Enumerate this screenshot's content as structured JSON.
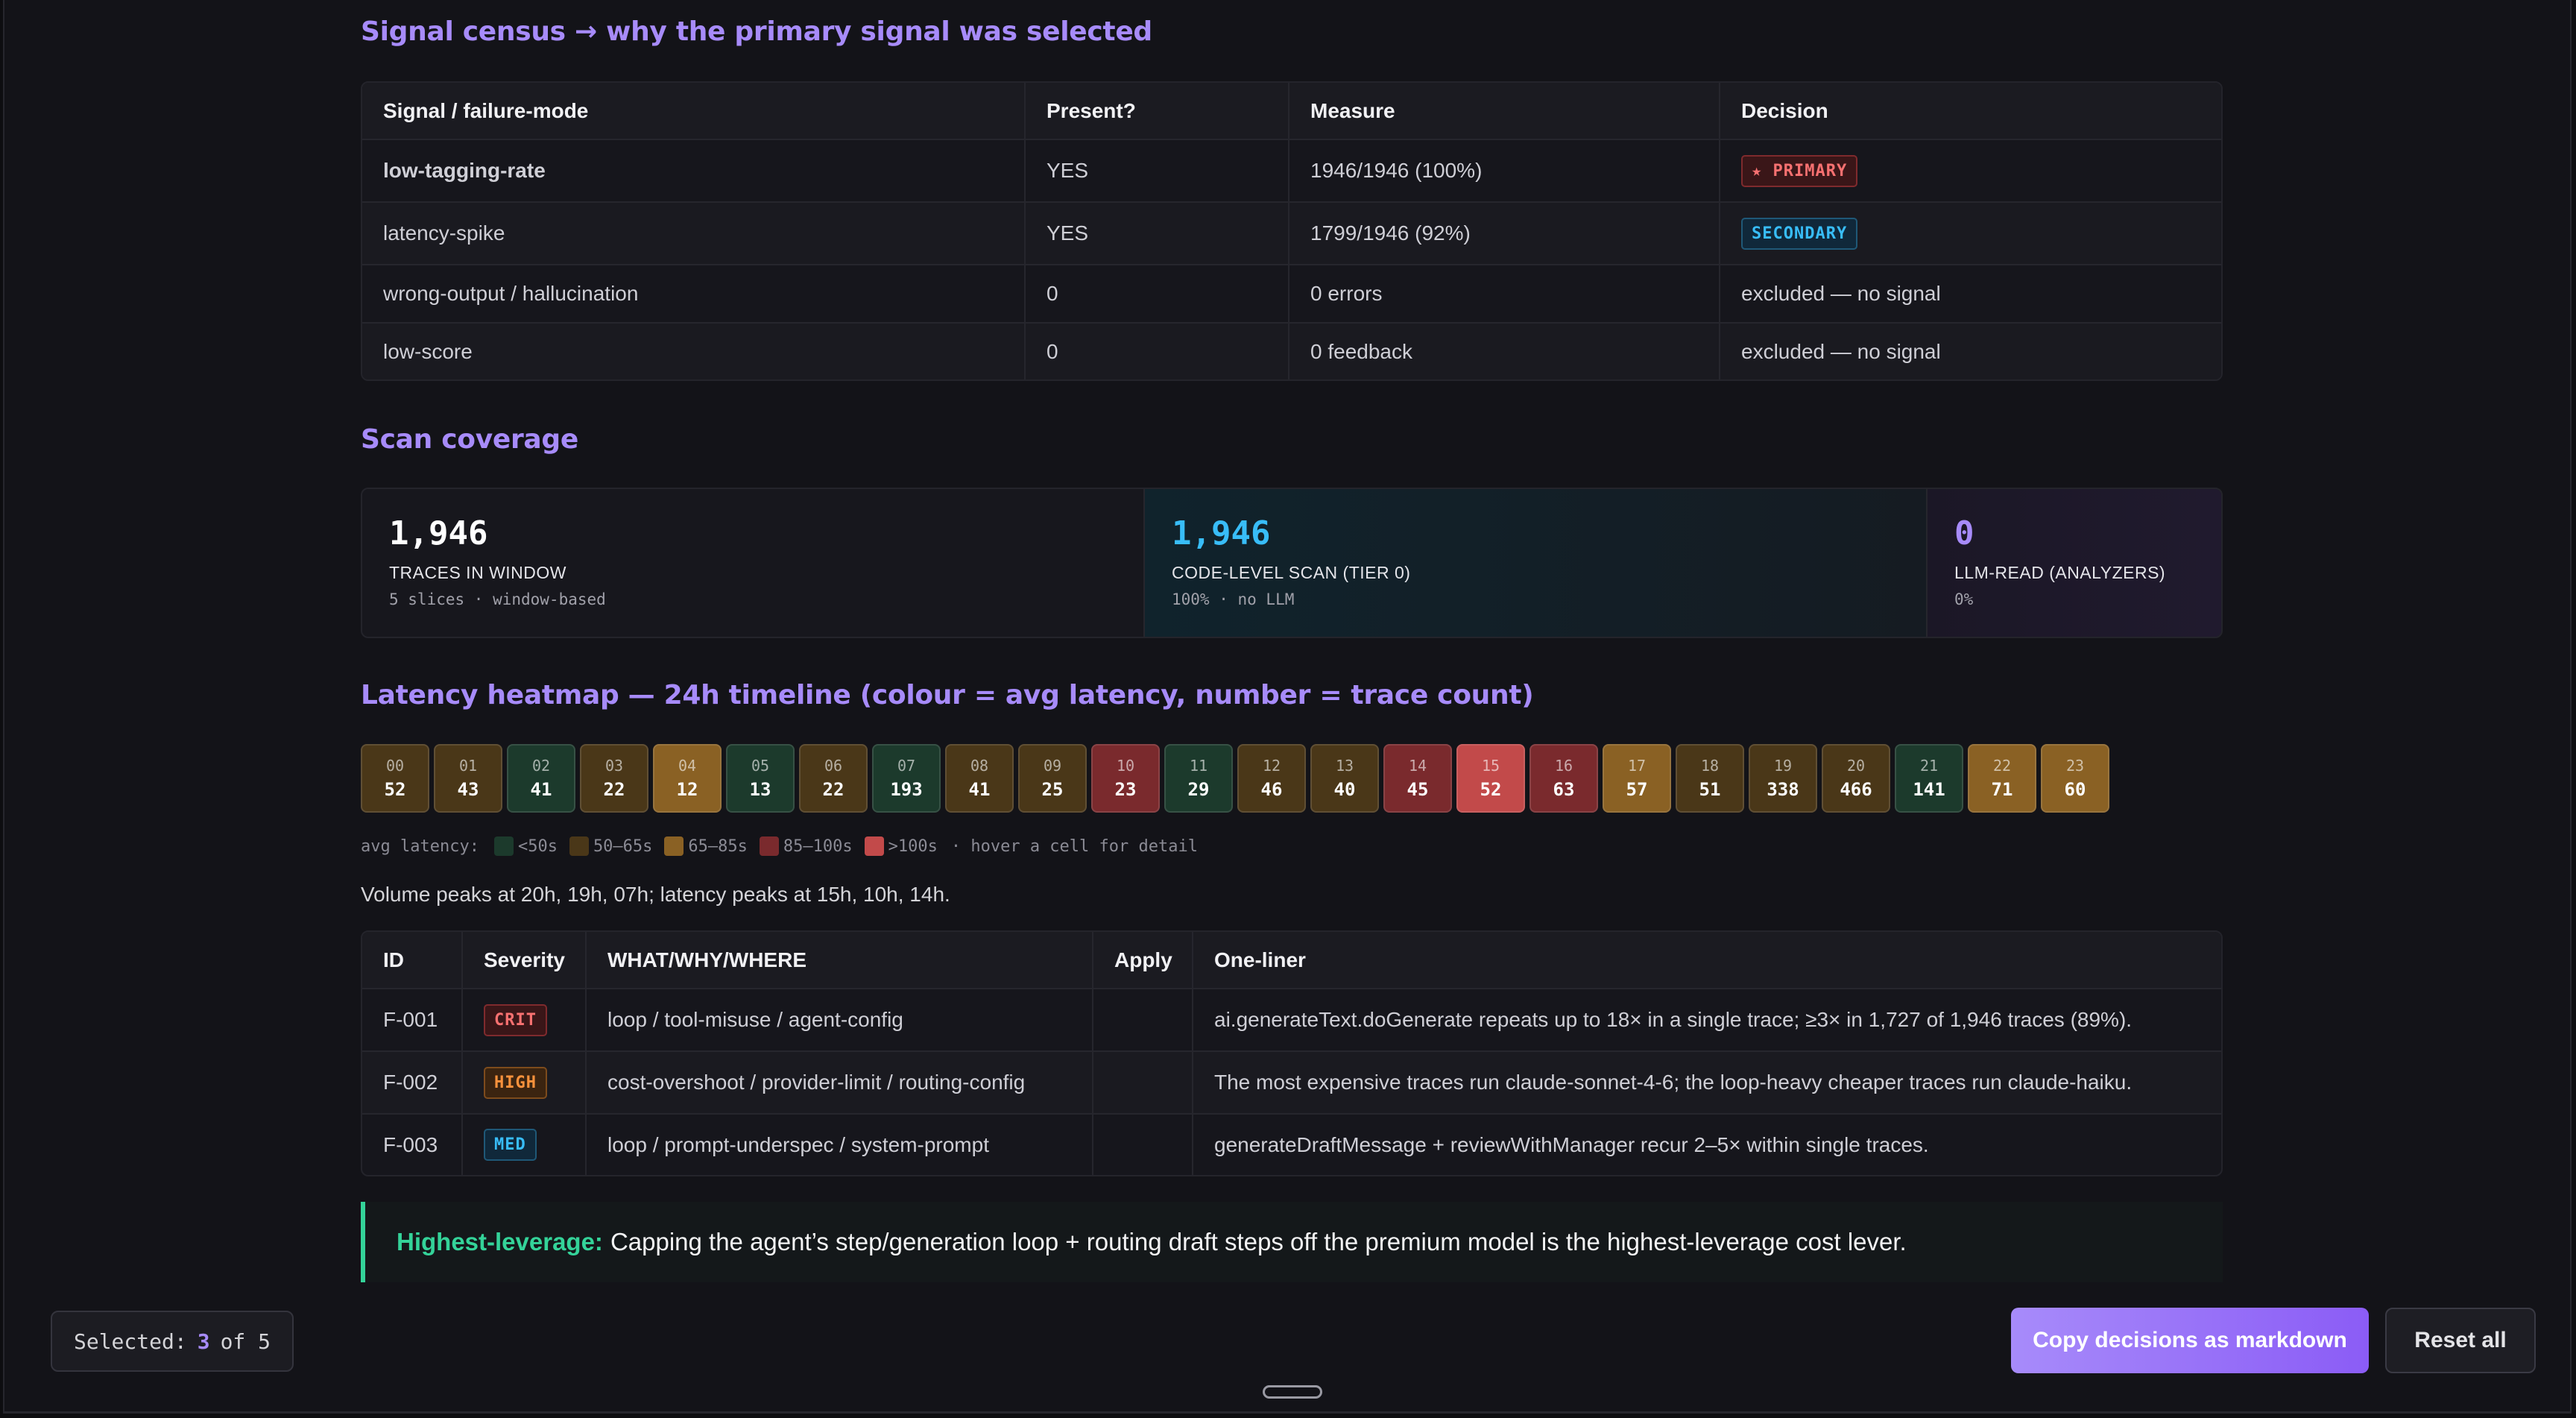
{
  "census": {
    "title": "Signal census → why the primary signal was selected",
    "headers": [
      "Signal / failure-mode",
      "Present?",
      "Measure",
      "Decision"
    ],
    "rows": [
      {
        "signal": "low-tagging-rate",
        "present": "YES",
        "measure": "1946/1946 (100%)",
        "decision": "★ PRIMARY"
      },
      {
        "signal": "latency-spike",
        "present": "YES",
        "measure": "1799/1946 (92%)",
        "decision": "SECONDARY"
      },
      {
        "signal": "wrong-output / hallucination",
        "present": "0",
        "measure": "0 errors",
        "decision": "excluded — no signal"
      },
      {
        "signal": "low-score",
        "present": "0",
        "measure": "0 feedback",
        "decision": "excluded — no signal"
      }
    ]
  },
  "coverage": {
    "title": "Scan coverage",
    "cards": [
      {
        "num": "1,946",
        "label": "TRACES IN WINDOW",
        "sub": "5 slices · window-based",
        "color": "#ffffff"
      },
      {
        "num": "1,946",
        "label": "CODE-LEVEL SCAN (TIER 0)",
        "sub": "100% · no LLM",
        "color": "#38bdf8"
      },
      {
        "num": "0",
        "label": "LLM-READ (ANALYZERS)",
        "sub": "0%",
        "color": "#a78bfa"
      }
    ]
  },
  "heatmap": {
    "title": "Latency heatmap — 24h timeline (colour = avg latency, number = trace count)",
    "cells": [
      {
        "hour": "00",
        "count": 52,
        "level": "b"
      },
      {
        "hour": "01",
        "count": 43,
        "level": "b"
      },
      {
        "hour": "02",
        "count": 41,
        "level": "a"
      },
      {
        "hour": "03",
        "count": 22,
        "level": "b"
      },
      {
        "hour": "04",
        "count": 12,
        "level": "c"
      },
      {
        "hour": "05",
        "count": 13,
        "level": "a"
      },
      {
        "hour": "06",
        "count": 22,
        "level": "b"
      },
      {
        "hour": "07",
        "count": 193,
        "level": "a"
      },
      {
        "hour": "08",
        "count": 41,
        "level": "b"
      },
      {
        "hour": "09",
        "count": 25,
        "level": "b"
      },
      {
        "hour": "10",
        "count": 23,
        "level": "d"
      },
      {
        "hour": "11",
        "count": 29,
        "level": "a"
      },
      {
        "hour": "12",
        "count": 46,
        "level": "b"
      },
      {
        "hour": "13",
        "count": 40,
        "level": "b"
      },
      {
        "hour": "14",
        "count": 45,
        "level": "d"
      },
      {
        "hour": "15",
        "count": 52,
        "level": "e"
      },
      {
        "hour": "16",
        "count": 63,
        "level": "d"
      },
      {
        "hour": "17",
        "count": 57,
        "level": "c"
      },
      {
        "hour": "18",
        "count": 51,
        "level": "b"
      },
      {
        "hour": "19",
        "count": 338,
        "level": "b"
      },
      {
        "hour": "20",
        "count": 466,
        "level": "b"
      },
      {
        "hour": "21",
        "count": 141,
        "level": "a"
      },
      {
        "hour": "22",
        "count": 71,
        "level": "c"
      },
      {
        "hour": "23",
        "count": 60,
        "level": "c"
      }
    ],
    "legend": {
      "prefix": "avg latency:",
      "items": [
        {
          "label": "<50s",
          "color": "#1c3a2c"
        },
        {
          "label": "50–65s",
          "color": "#4a3718"
        },
        {
          "label": "65–85s",
          "color": "#8a6124"
        },
        {
          "label": "85–100s",
          "color": "#7a2a2d"
        },
        {
          "label": ">100s",
          "color": "#c24a4a"
        }
      ],
      "hint": "· hover a cell for detail"
    },
    "peaks": "Volume peaks at 20h, 19h, 07h; latency peaks at 15h, 10h, 14h."
  },
  "findings": {
    "headers": [
      "ID",
      "Severity",
      "WHAT/WHY/WHERE",
      "Apply",
      "One-liner"
    ],
    "rows": [
      {
        "id": "F-001",
        "severity": "CRIT",
        "what": "loop / tool-misuse / agent-config",
        "apply": "",
        "one_liner": "ai.generateText.doGenerate repeats up to 18× in a single trace; ≥3× in 1,727 of 1,946 traces (89%)."
      },
      {
        "id": "F-002",
        "severity": "HIGH",
        "what": "cost-overshoot / provider-limit / routing-config",
        "apply": "",
        "one_liner": "The most expensive traces run claude-sonnet-4-6; the loop-heavy cheaper traces run claude-haiku."
      },
      {
        "id": "F-003",
        "severity": "MED",
        "what": "loop / prompt-underspec / system-prompt",
        "apply": "",
        "one_liner": "generateDraftMessage + reviewWithManager recur 2–5× within single traces."
      }
    ]
  },
  "callout": {
    "label": "Highest-leverage:",
    "text": "Capping the agent’s step/generation loop + routing draft steps off the premium model is the highest-leverage cost lever."
  },
  "footer": {
    "selected_prefix": "Selected:",
    "selected_count": "3",
    "selected_suffix": "of 5",
    "copy_label": "Copy decisions as markdown",
    "reset_label": "Reset all"
  }
}
